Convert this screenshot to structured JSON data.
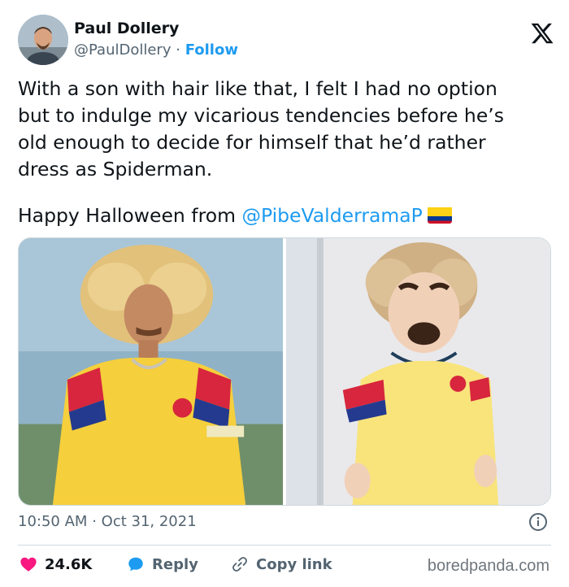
{
  "author": {
    "name": "Paul Dollery",
    "handle": "@PaulDollery",
    "separator": "·",
    "follow_label": "Follow"
  },
  "tweet": {
    "lines": [
      "With a son with hair like that, I felt I had no option",
      "but to indulge my vicarious tendencies before he’s",
      "old enough to decide for himself that he’d rather",
      "dress as Spiderman."
    ],
    "halloween_prefix": "Happy Halloween from ",
    "mention": "@PibeValderramaP",
    "flag_colors": [
      "#fcd116",
      "#003893",
      "#ce1126"
    ]
  },
  "meta": {
    "time": "10:50 AM",
    "separator": "·",
    "date": "Oct 31, 2021"
  },
  "actions": {
    "like_count": "24.6K",
    "reply_label": "Reply",
    "copy_label": "Copy link"
  },
  "watermark": "boredpanda.com",
  "colors": {
    "accent": "#1d9bf0",
    "like": "#f91880",
    "text": "#0f1419",
    "muted": "#536471"
  },
  "icons": [
    "x-logo-icon",
    "info-icon",
    "heart-icon",
    "reply-bubble-icon",
    "link-icon"
  ]
}
